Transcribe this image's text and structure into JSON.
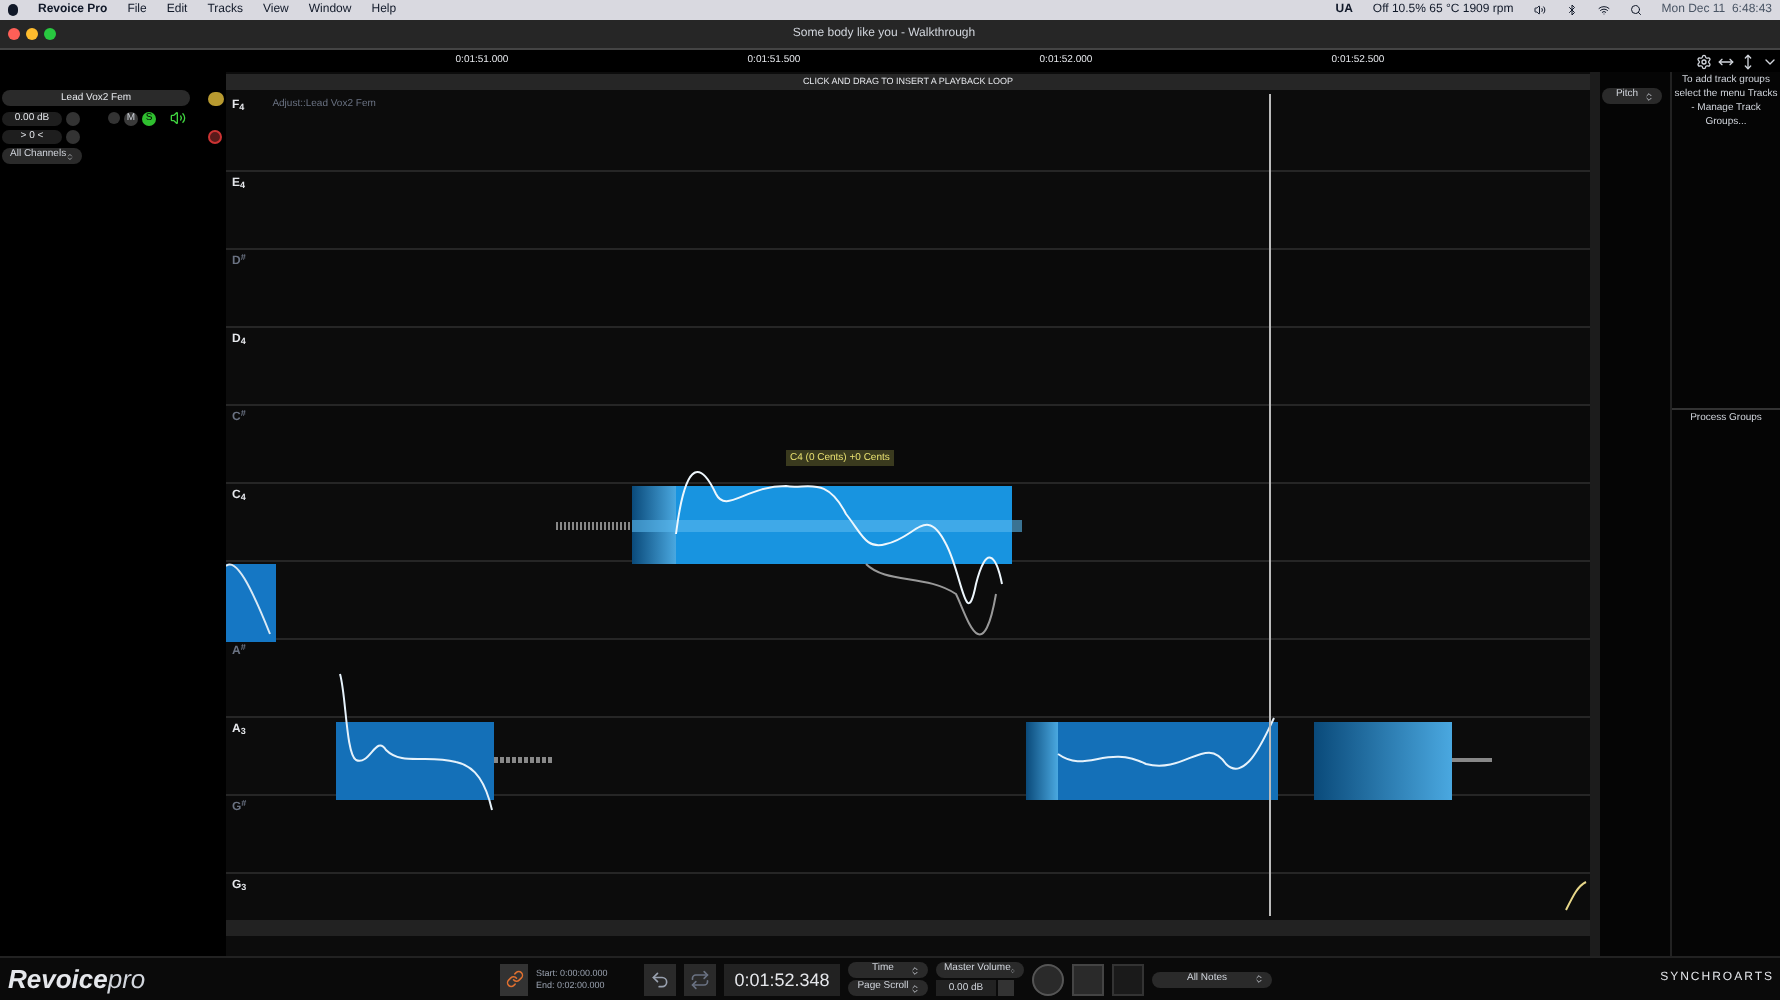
{
  "menu_bar": {
    "app": "Revoice Pro",
    "menus": [
      "File",
      "Edit",
      "Tracks",
      "View",
      "Window",
      "Help"
    ],
    "status": [
      "UA",
      "Off 10.5% 65 °C 1909 rpm"
    ],
    "clock": "Mon Dec 11  6:48:43"
  },
  "window": {
    "title": "Some body like you - Walkthrough"
  },
  "ruler": {
    "times": [
      "0:01:51.000",
      "0:01:51.500",
      "0:01:52.000",
      "0:01:52.500"
    ],
    "loop_hint": "CLICK AND DRAG TO INSERT A PLAYBACK LOOP"
  },
  "track": {
    "name": "Lead Vox2 Fem",
    "gain": "0.00 dB",
    "pan": "> 0 <",
    "channels": "All Channels",
    "mute": {
      "label": "M",
      "on": false
    },
    "solo": {
      "label": "S",
      "on": true
    }
  },
  "editor": {
    "adjust_label": "Adjust::Lead Vox2 Fem",
    "tooltip": "C4 (0 Cents) +0 Cents",
    "lanes": [
      {
        "note": "F$_{4}$",
        "kind": "natural"
      },
      {
        "note": "E$_{4}$",
        "kind": "natural"
      },
      {
        "note": "D$^{#}$",
        "kind": "sharp"
      },
      {
        "note": "D$_{4}$",
        "kind": "natural"
      },
      {
        "note": "C$^{#}$",
        "kind": "sharp"
      },
      {
        "note": "C$_{4}$",
        "kind": "natural"
      },
      {
        "kind": "natural"
      },
      {
        "note": "A$^{#}$",
        "kind": "sharp"
      },
      {
        "note": "A$_{3}$",
        "kind": "natural"
      },
      {
        "note": "G$^{#}$",
        "kind": "sharp"
      },
      {
        "note": "G$_{3}$",
        "kind": "natural"
      }
    ]
  },
  "side": {
    "view_select": "Pitch",
    "track_groups_hint": "To add track groups select the menu Tracks - Manage Track Groups...",
    "process_groups": "Process Groups"
  },
  "transport": {
    "logo": {
      "name": "Revoice",
      "suffix": "pro"
    },
    "start": "Start: 0:00:00.000",
    "end": "End: 0:02:00.000",
    "time": "0:01:52.348",
    "scroll_mode": "Time",
    "scroll_type": "Page Scroll",
    "volume_label": "Master Volume",
    "volume": "0.00 dB",
    "note_filter": "All Notes",
    "brand": "SYNCHROARTS"
  }
}
